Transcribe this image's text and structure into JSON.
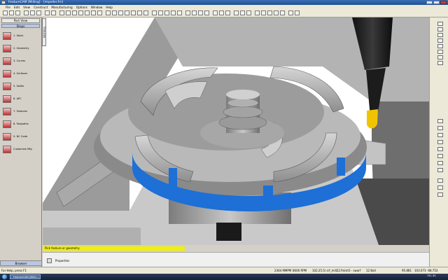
{
  "window": {
    "title": "FeatureCAM [Milling] - [impeller.fm]"
  },
  "menu": [
    "File",
    "Edit",
    "View",
    "Construct",
    "Manufacturing",
    "Options",
    "Window",
    "Help"
  ],
  "left_panel": {
    "title": "Part View",
    "tab": "Steps",
    "steps": [
      "1. Stock",
      "2. Geometry",
      "3. Curves",
      "4. Surfaces",
      "5. Solids",
      "6. APC",
      "7. Features",
      "8. Toolpaths",
      "9. NC Code",
      "Customize Mfg"
    ],
    "bottom_tab": "Browser"
  },
  "view_toolbar_label": "TOOLBOX",
  "prompt": "Pick feature or geometry",
  "properties_label": "Properties",
  "status": {
    "help": "For Help, press F1",
    "feed": "2364 MMPM",
    "rpm": "8000 RPM",
    "operation": "102.25.5/ srf_mill22.finish5 - swarf",
    "tool": "12 Ball",
    "x": "95.881",
    "y": "103.073",
    "z": "-68.753",
    "time": "741.30"
  },
  "taskbar": {
    "item": "FeatureCAM [Millin...",
    "clock": "741.30"
  },
  "colors": {
    "accent_blue": "#1e6fd6",
    "prompt_yellow": "#f2f000",
    "tool_yellow": "#f0c400"
  }
}
